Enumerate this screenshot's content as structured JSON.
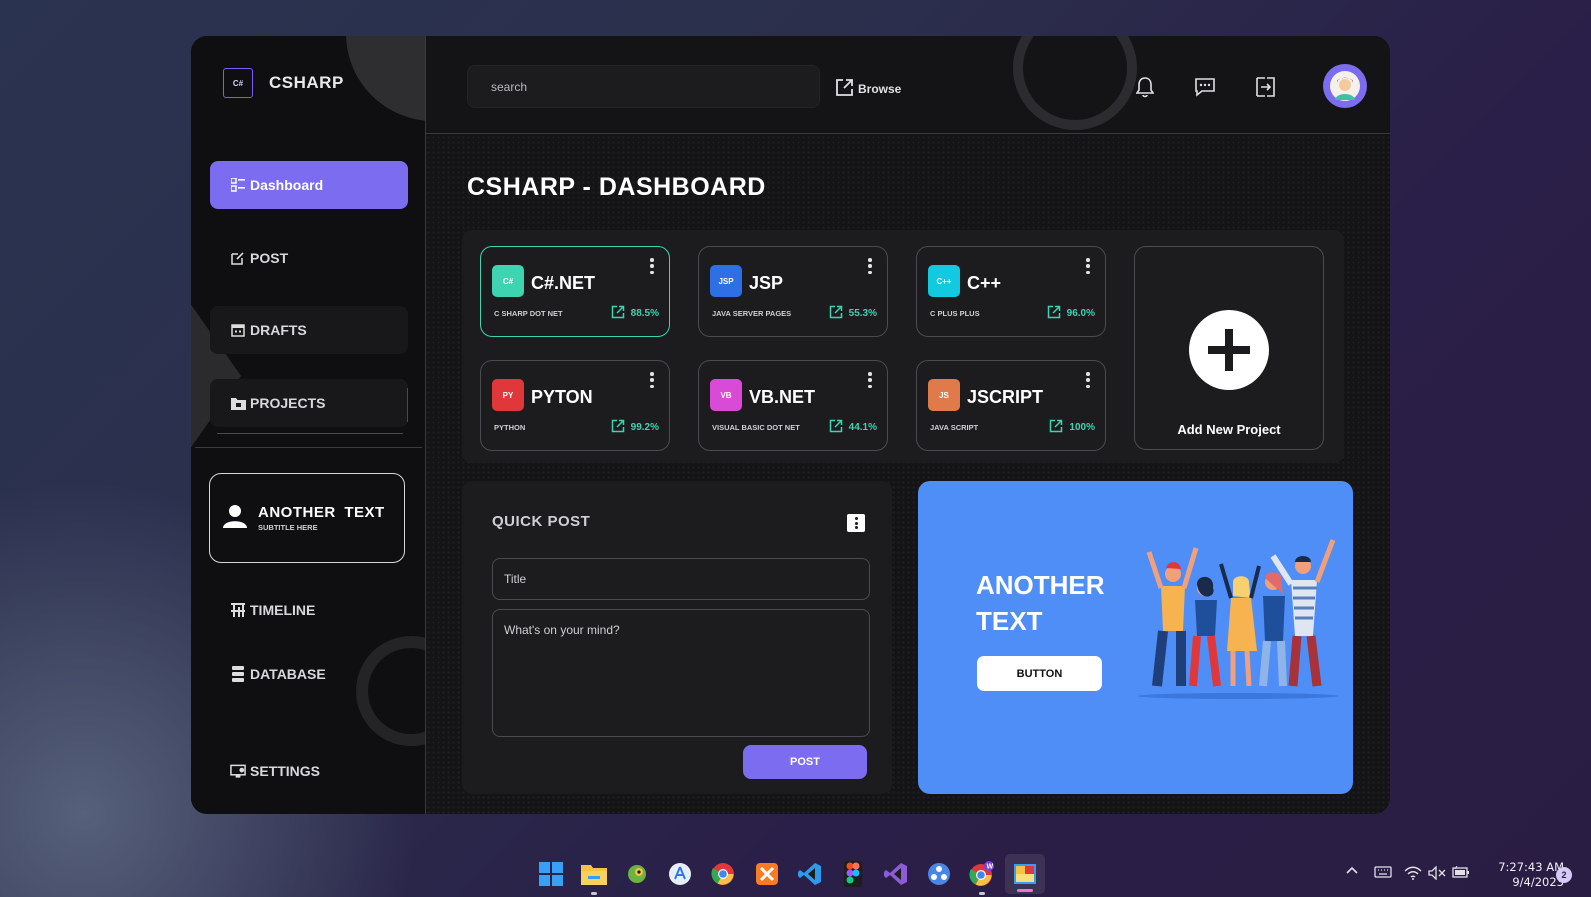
{
  "app": {
    "logo_badge": "C#",
    "logo_text": "CSHARP"
  },
  "sidebar": {
    "items": [
      {
        "label": "Dashboard",
        "icon": "dashboard-icon"
      },
      {
        "label": "POST",
        "icon": "edit-icon"
      },
      {
        "label": "DRAFTS",
        "icon": "calendar-icon"
      },
      {
        "label": "PROJECTS",
        "icon": "folder-icon"
      },
      {
        "label": "TIMELINE",
        "icon": "timeline-icon"
      },
      {
        "label": "DATABASE",
        "icon": "database-icon"
      },
      {
        "label": "SETTINGS",
        "icon": "monitor-settings-icon"
      }
    ],
    "profile": {
      "title": "ANOTHER TEXT",
      "subtitle": "SUBTITLE HERE"
    }
  },
  "topbar": {
    "search_placeholder": "search",
    "browse_label": "Browse"
  },
  "main": {
    "page_title": "CSHARP - DASHBOARD",
    "projects": [
      {
        "badge": "C#",
        "name": "C#.NET",
        "desc": "C SHARP DOT NET",
        "pct": "88.5%",
        "color": "#3ed3b1"
      },
      {
        "badge": "JSP",
        "name": "JSP",
        "desc": "JAVA SERVER PAGES",
        "pct": "55.3%",
        "color": "#2f6fe6"
      },
      {
        "badge": "C++",
        "name": "C++",
        "desc": "C PLUS PLUS",
        "pct": "96.0%",
        "color": "#13c9e0"
      },
      {
        "badge": "PY",
        "name": "PYTON",
        "desc": "PYTHON",
        "pct": "99.2%",
        "color": "#e0383a"
      },
      {
        "badge": "VB",
        "name": "VB.NET",
        "desc": "VISUAL BASIC DOT NET",
        "pct": "44.1%",
        "color": "#d94ad6"
      },
      {
        "badge": "JS",
        "name": "JSCRIPT",
        "desc": "JAVA SCRIPT",
        "pct": "100%",
        "color": "#e07a4a"
      }
    ],
    "add_project_label": "Add New Project",
    "quick_post": {
      "title": "QUICK POST",
      "title_placeholder": "Title",
      "body_placeholder": "What's on your mind?",
      "post_label": "POST"
    },
    "promo": {
      "title": "ANOTHER TEXT",
      "button_label": "BUTTON"
    }
  },
  "taskbar": {
    "time": "7:27:43 AM",
    "date": "9/4/2023",
    "notification_count": "2"
  },
  "colors": {
    "accent": "#7c6cf0",
    "success": "#3ed3b1",
    "promo_bg": "#4f8ef7"
  }
}
